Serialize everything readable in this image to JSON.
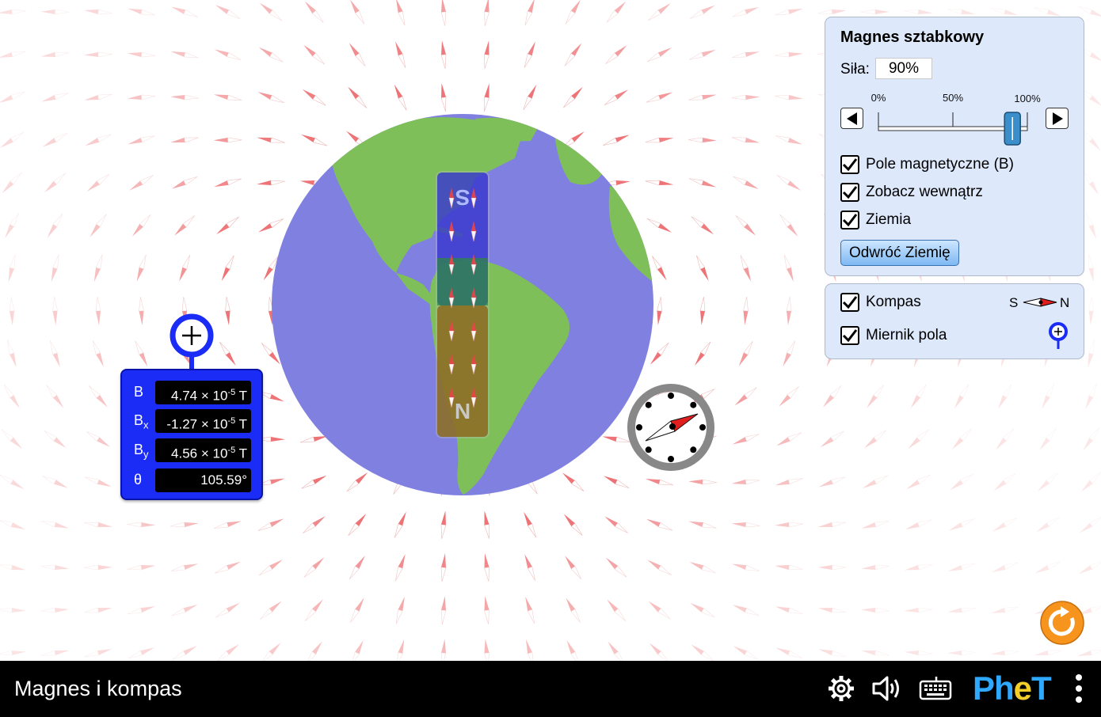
{
  "sim": {
    "title": "Magnes i kompas"
  },
  "magnet_panel": {
    "title": "Magnes sztabkowy",
    "strength_label": "Siła:",
    "strength_value": "90%",
    "strength_fraction": 0.9,
    "ticks": [
      "0%",
      "50%",
      "100%"
    ],
    "checkboxes": [
      {
        "label": "Pole magnetyczne (B)",
        "checked": true
      },
      {
        "label": "Zobacz wewnątrz",
        "checked": true
      },
      {
        "label": "Ziemia",
        "checked": true
      }
    ],
    "flip_button": "Odwróć Ziemię"
  },
  "tools_panel": {
    "compass_label": "Kompas",
    "compass_checked": true,
    "compass_legend_s": "S",
    "compass_legend_n": "N",
    "meter_label": "Miernik pola",
    "meter_checked": true
  },
  "magnet": {
    "north_label": "N",
    "south_label": "S"
  },
  "field_meter": {
    "rows": [
      {
        "label": "B",
        "sub": "",
        "mantissa": "4.74 × 10",
        "exp": "-5",
        "unit": " T"
      },
      {
        "label": "B",
        "sub": "x",
        "mantissa": "-1.27 × 10",
        "exp": "-5",
        "unit": " T"
      },
      {
        "label": "B",
        "sub": "y",
        "mantissa": "4.56 × 10",
        "exp": "-5",
        "unit": " T"
      }
    ],
    "theta_label": "θ",
    "theta_value": "105.59°"
  },
  "compass": {
    "needle_angle_deg": -25
  },
  "colors": {
    "earth_ocean": "#8080e0",
    "land": "#7fbf5a",
    "panel_bg": "#dde8fb",
    "meter_blue": "#1a2cf5",
    "needle_red": "#e11e1e",
    "reset_orange": "#f7941d",
    "phet_blue": "#2fa8ff",
    "phet_yellow": "#f3ce2a"
  },
  "icons": {
    "settings": "gear-icon",
    "audio": "speaker-icon",
    "keyboard": "keyboard-icon",
    "menu": "vertical-dots-icon",
    "reset": "reset-all-icon"
  }
}
